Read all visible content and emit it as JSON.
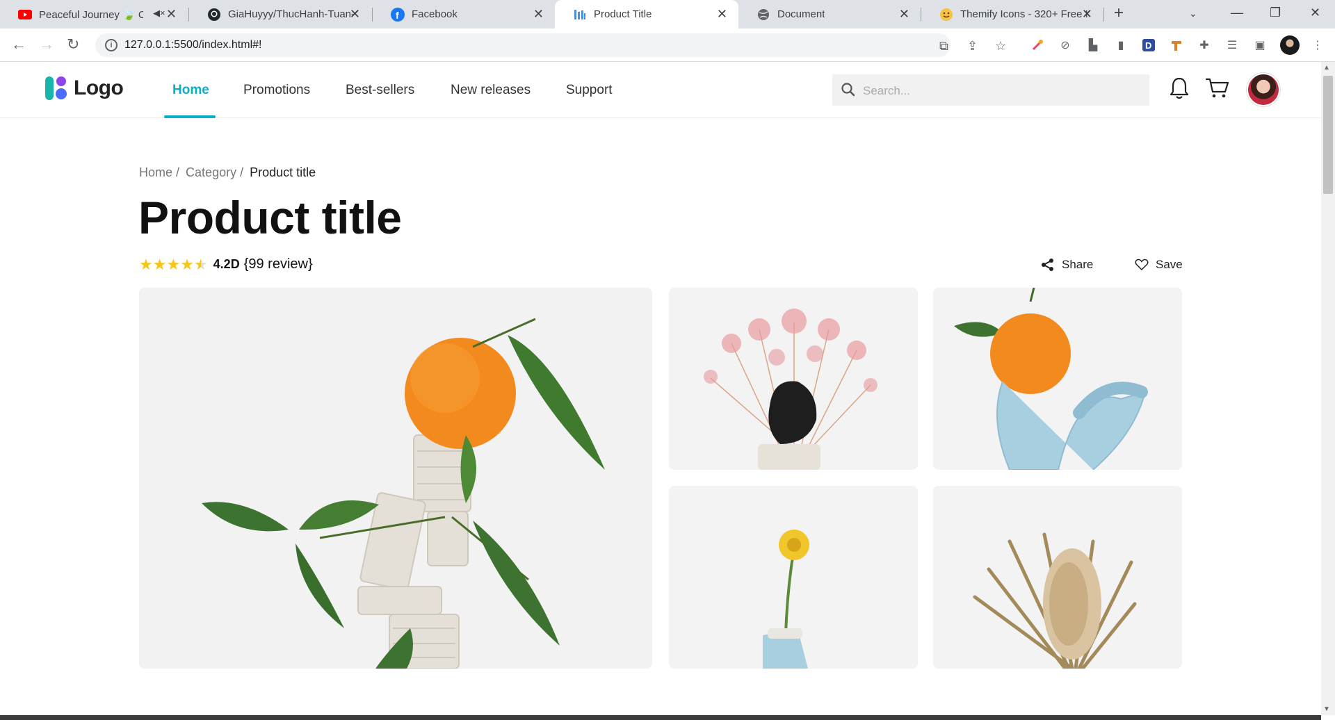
{
  "browser": {
    "tabs": [
      {
        "label": "Peaceful Journey 🍃 Ch",
        "icon": "youtube-icon",
        "muted": true
      },
      {
        "label": "GiaHuyyy/ThucHanh-Tuan-",
        "icon": "github-icon"
      },
      {
        "label": "Facebook",
        "icon": "facebook-icon"
      },
      {
        "label": "Product Title",
        "icon": "site-favicon",
        "active": true
      },
      {
        "label": "Document",
        "icon": "globe-icon"
      },
      {
        "label": "Themify Icons - 320+ Free I",
        "icon": "themify-icon"
      }
    ],
    "url": "127.0.0.1:5500/index.html#!"
  },
  "site": {
    "logo_text": "Logo",
    "nav": [
      "Home",
      "Promotions",
      "Best-sellers",
      "New releases",
      "Support"
    ],
    "active_nav": "Home",
    "search_placeholder": "Search..."
  },
  "product": {
    "breadcrumb": [
      "Home /",
      "Category /",
      "Product title"
    ],
    "title": "Product title",
    "rating_value": "4.2D",
    "rating_count": "{99 review}",
    "stars": 4.5,
    "share_label": "Share",
    "save_label": "Save"
  },
  "gallery": [
    "orange-on-ceramic-stack",
    "pink-dried-flowers",
    "orange-on-blue-ceramic",
    "yellow-flower-vase",
    "dried-banksia"
  ],
  "colors": {
    "accent": "#0ab0c6",
    "star": "#f5c518"
  }
}
